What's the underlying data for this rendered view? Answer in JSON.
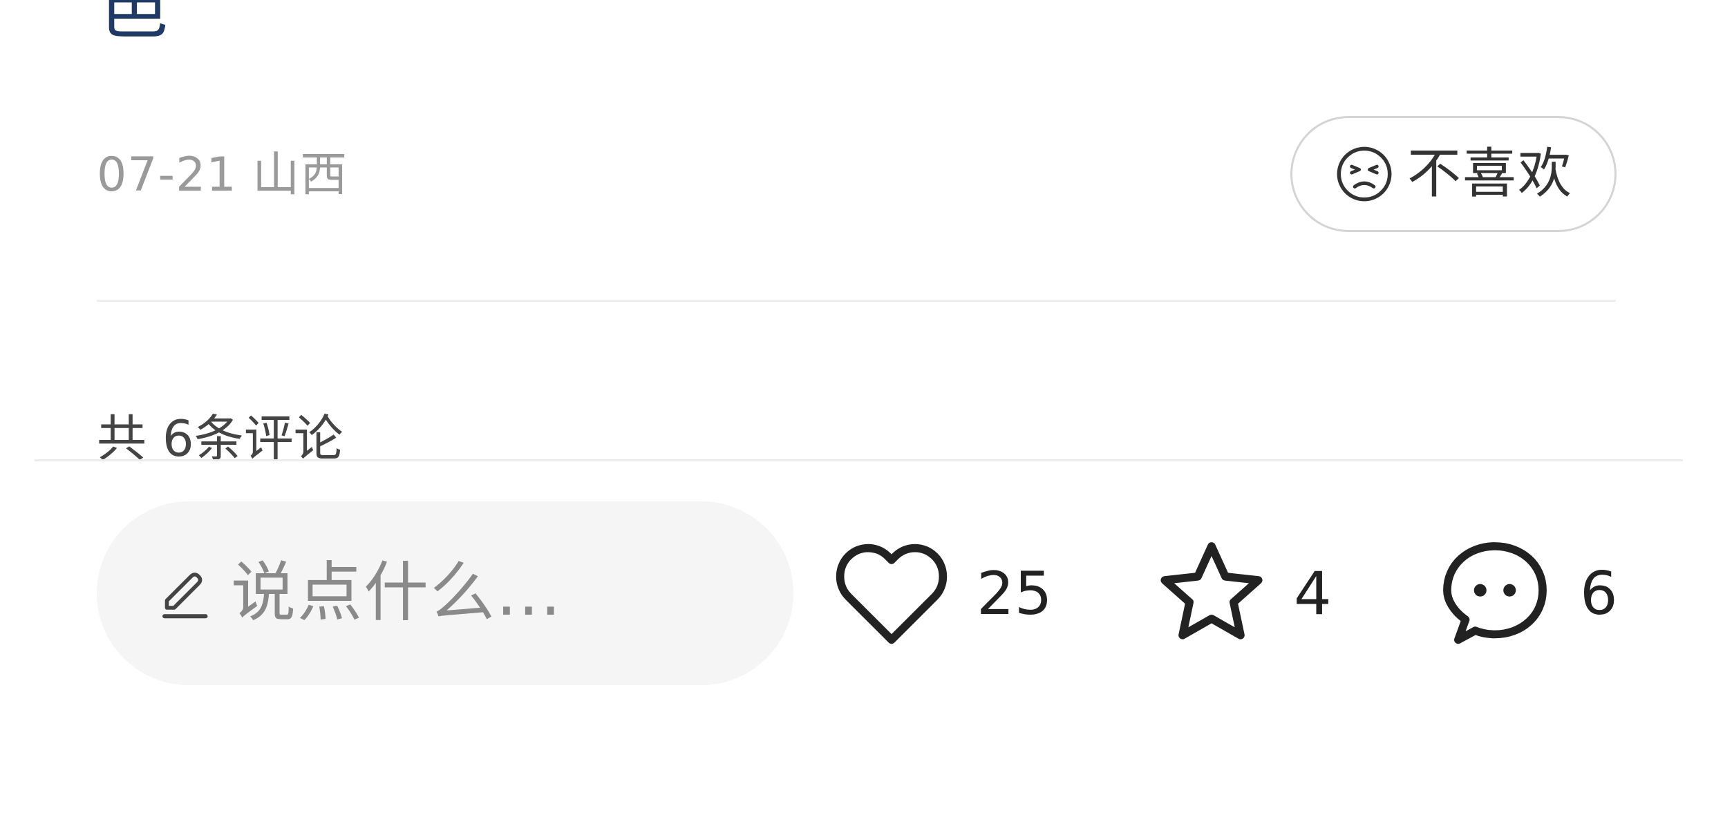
{
  "post": {
    "title_tail": "邑",
    "date": "07-21",
    "location": "山西",
    "dislike_label": "不喜欢",
    "dislike_icon": "frown-face-icon"
  },
  "comments": {
    "count_label": "共 6条评论"
  },
  "bottom_bar": {
    "input_placeholder": "说点什么...",
    "input_icon": "pencil-icon",
    "likes": "25",
    "collects": "4",
    "comments": "6",
    "like_icon": "heart-icon",
    "collect_icon": "star-icon",
    "comment_icon": "chat-bubble-icon"
  }
}
